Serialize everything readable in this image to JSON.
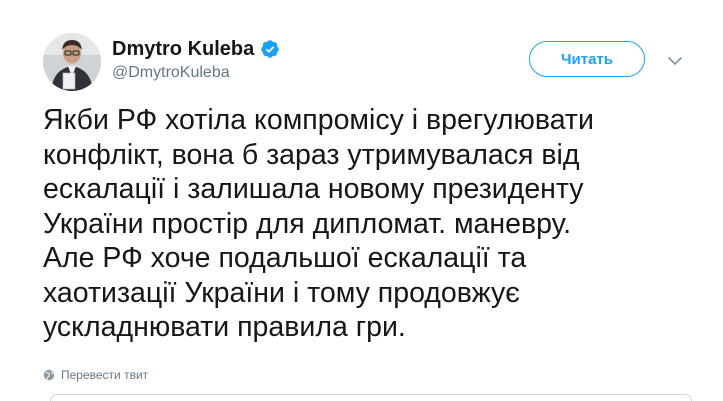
{
  "author": {
    "name": "Dmytro Kuleba",
    "handle": "@DmytroKuleba",
    "verified": true
  },
  "follow_button": {
    "label": "Читать"
  },
  "tweet": {
    "text": "Якби РФ хотіла компромісу і врегулювати\nконфлікт, вона б зараз утримувалася від\nескалації і залишала новому президенту\nУкраїни простір для дипломат. маневру.\nАле РФ хоче подальшої ескалації та\nхаотизації України і тому продовжує\nускладнювати правила гри."
  },
  "translate": {
    "label": "Перевести твит"
  },
  "colors": {
    "accent": "#1da1f2",
    "text": "#14171a",
    "muted": "#657786"
  },
  "icons": {
    "verified": "verified-badge-icon",
    "caret": "chevron-down-icon",
    "globe": "globe-icon"
  }
}
